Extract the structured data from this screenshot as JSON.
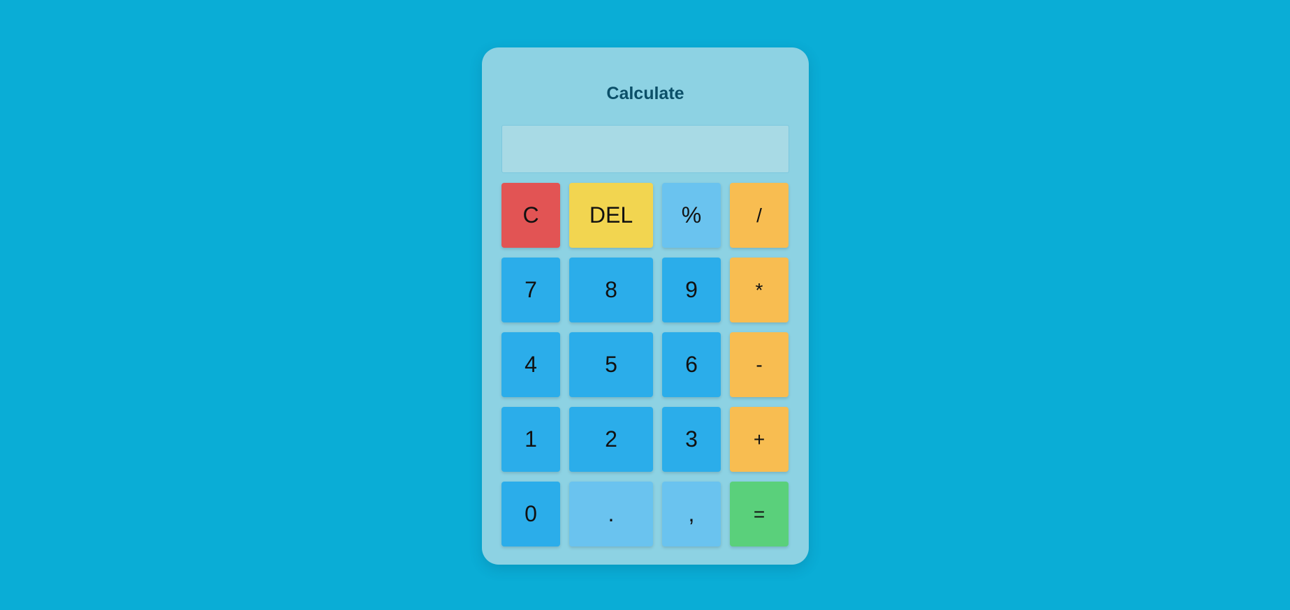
{
  "title": "Calculate",
  "display": {
    "value": "",
    "placeholder": ""
  },
  "keys": {
    "clear": "C",
    "delete": "DEL",
    "percent": "%",
    "divide": "/",
    "seven": "7",
    "eight": "8",
    "nine": "9",
    "multiply": "*",
    "four": "4",
    "five": "5",
    "six": "6",
    "minus": "-",
    "one": "1",
    "two": "2",
    "three": "3",
    "plus": "+",
    "zero": "0",
    "dot": ".",
    "comma": ",",
    "equals": "="
  },
  "colors": {
    "background": "#0aadd6",
    "panel": "#8dd2e3",
    "number_key": "#2badea",
    "light_key": "#6ac3ef",
    "operator_key": "#f8bd51",
    "clear_key": "#e25454",
    "delete_key": "#f2d550",
    "equals_key": "#5ad07b"
  }
}
